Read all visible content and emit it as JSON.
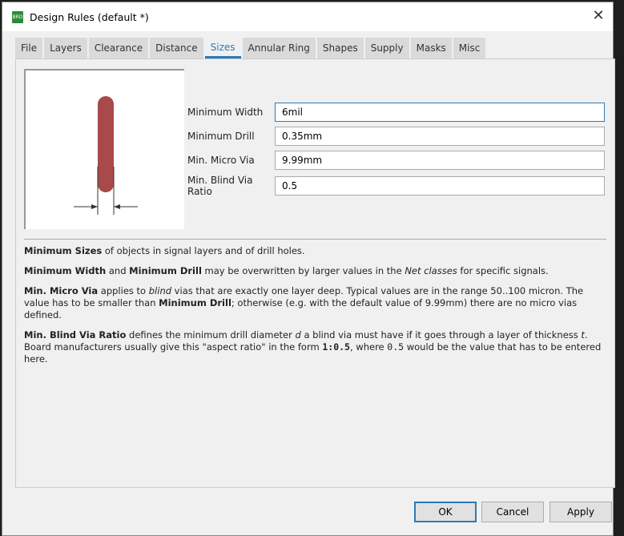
{
  "title": "Design Rules (default *)",
  "app_icon": "BRD",
  "tabs": [
    {
      "label": "File"
    },
    {
      "label": "Layers"
    },
    {
      "label": "Clearance"
    },
    {
      "label": "Distance"
    },
    {
      "label": "Sizes",
      "active": true
    },
    {
      "label": "Annular Ring"
    },
    {
      "label": "Shapes"
    },
    {
      "label": "Supply"
    },
    {
      "label": "Masks"
    },
    {
      "label": "Misc"
    }
  ],
  "fields": [
    {
      "label": "Minimum Width",
      "value": "6mil"
    },
    {
      "label": "Minimum Drill",
      "value": "0.35mm"
    },
    {
      "label": "Min. Micro Via",
      "value": "9.99mm"
    },
    {
      "label": "Min. Blind Via Ratio",
      "value": "0.5"
    }
  ],
  "desc": {
    "p1_b": "Minimum Sizes",
    "p1": " of objects in signal layers and of drill holes.",
    "p2_b1": "Minimum Width",
    "p2_a": " and ",
    "p2_b2": "Minimum Drill",
    "p2_c": " may be overwritten by larger values in the ",
    "p2_i": "Net classes",
    "p2_d": " for specific signals.",
    "p3_b1": "Min. Micro Via",
    "p3_a": " applies to ",
    "p3_i": "blind",
    "p3_c": " vias that are exactly one layer deep. Typical values are in the range 50..100 micron. The value has to be smaller than ",
    "p3_b2": "Minimum Drill",
    "p3_d": "; otherwise (e.g. with the default value of 9.99mm) there are no micro vias defined.",
    "p4_b": "Min. Blind Via Ratio",
    "p4_a": " defines the minimum drill diameter ",
    "p4_i1": "d",
    "p4_c": " a blind via must have if it goes through a layer of thickness ",
    "p4_i2": "t",
    "p4_d": ". Board manufacturers usually give this \"aspect ratio\" in the form ",
    "p4_m1": "1:0.5",
    "p4_e": ", where ",
    "p4_m2": "0.5",
    "p4_f": " would be the value that has to be entered here."
  },
  "buttons": {
    "ok": "OK",
    "cancel": "Cancel",
    "apply": "Apply"
  },
  "colors": {
    "accent": "#2a7ab8",
    "via": "#a84a4a"
  }
}
